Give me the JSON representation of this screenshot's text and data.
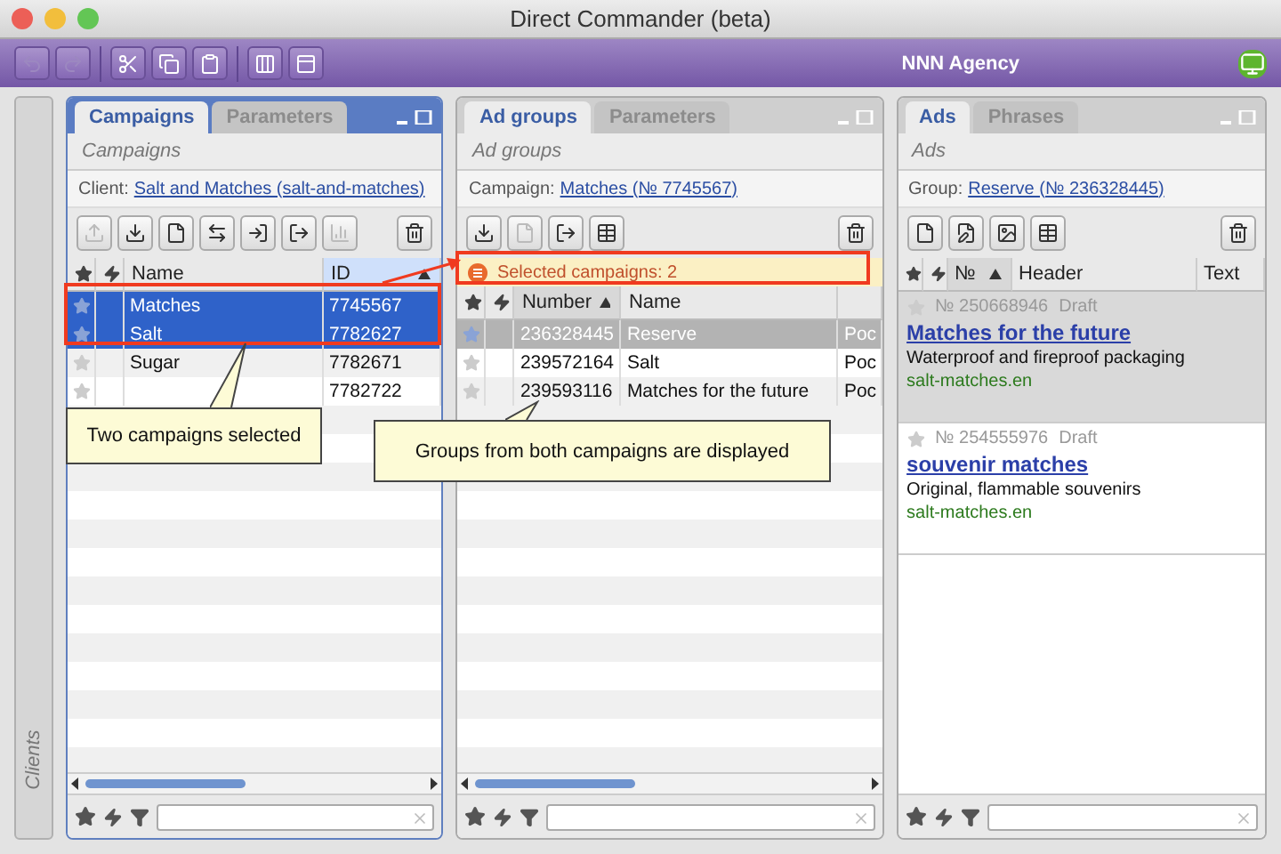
{
  "window": {
    "title": "Direct Commander (beta)"
  },
  "toolbar": [
    {
      "kind": "undo",
      "disabled": true
    },
    {
      "kind": "redo",
      "disabled": true
    },
    {
      "kind": "cut",
      "disabled": false
    },
    {
      "kind": "copy",
      "disabled": false
    },
    {
      "kind": "paste",
      "disabled": false
    },
    {
      "kind": "columns",
      "disabled": false
    },
    {
      "kind": "view",
      "disabled": false
    }
  ],
  "account": "NNN Agency",
  "sidebar": {
    "label": "Clients"
  },
  "panels": [
    {
      "kind": "table",
      "active": true,
      "tabs": [
        {
          "label": "Campaigns",
          "selected": true
        },
        {
          "label": "Parameters",
          "selected": false
        }
      ],
      "subtitle": "Campaigns",
      "filter": {
        "label": "Client:",
        "value": "Salt and Matches (salt-and-matches)"
      },
      "tools": [
        {
          "kind": "upload",
          "disabled": true
        },
        {
          "kind": "download",
          "disabled": false
        },
        {
          "kind": "file",
          "disabled": false
        },
        {
          "kind": "swap",
          "disabled": false
        },
        {
          "kind": "import",
          "disabled": false
        },
        {
          "kind": "export",
          "disabled": false
        },
        {
          "kind": "chart",
          "disabled": true
        }
      ],
      "columns": [
        {
          "label": "Name",
          "sorted": false
        },
        {
          "label": "ID",
          "sorted": true
        }
      ],
      "rows": [
        {
          "cells": [
            "Matches",
            "7745567"
          ],
          "selected": true
        },
        {
          "cells": [
            "Salt",
            "7782627"
          ],
          "selected": true
        },
        {
          "cells": [
            "Sugar",
            "7782671"
          ],
          "selected": false
        },
        {
          "cells": [
            null,
            "7782722"
          ],
          "selected": false
        }
      ]
    },
    {
      "kind": "table",
      "active": false,
      "tabs": [
        {
          "label": "Ad groups",
          "selected": true
        },
        {
          "label": "Parameters",
          "selected": false
        }
      ],
      "subtitle": "Ad groups",
      "filter": {
        "label": "Campaign:",
        "value": "Matches (№ 7745567)"
      },
      "tools": [
        {
          "kind": "download",
          "disabled": false
        },
        {
          "kind": "file",
          "disabled": true
        },
        {
          "kind": "export",
          "disabled": false
        },
        {
          "kind": "grid",
          "disabled": false
        }
      ],
      "notice": "Selected campaigns: 2",
      "columns": [
        {
          "label": "Number",
          "sorted": true
        },
        {
          "label": "Name",
          "sorted": false
        },
        {
          "sorted": false
        }
      ],
      "rows": [
        {
          "cells": [
            "236328445",
            "Reserve",
            "Poc"
          ],
          "selected": true
        },
        {
          "cells": [
            "239572164",
            "Salt",
            "Poc"
          ],
          "selected": false
        },
        {
          "cells": [
            "239593116",
            "Matches for the future",
            "Poc"
          ],
          "selected": false
        }
      ]
    },
    {
      "kind": "cards",
      "active": false,
      "tabs": [
        {
          "label": "Ads",
          "selected": true
        },
        {
          "label": "Phrases",
          "selected": false
        }
      ],
      "subtitle": "Ads",
      "filter": {
        "label": "Group:",
        "value": "Reserve (№ 236328445)"
      },
      "tools": [
        {
          "kind": "file",
          "disabled": false
        },
        {
          "kind": "edit",
          "disabled": false
        },
        {
          "kind": "image",
          "disabled": false
        },
        {
          "kind": "grid",
          "disabled": false
        }
      ],
      "columns": [
        {
          "label": "№",
          "sorted": true
        },
        {
          "label": "Header",
          "sorted": false
        },
        {
          "label": "Text",
          "sorted": false
        }
      ],
      "cards": [
        {
          "number": "№ 250668946",
          "status": "Draft",
          "title": "Matches for the future",
          "text": "Waterproof and fireproof packaging",
          "url": "salt-matches.en",
          "selected": true
        },
        {
          "number": "№ 254555976",
          "status": "Draft",
          "title": "souvenir matches",
          "text": "Original, flammable souvenirs",
          "url": "salt-matches.en",
          "selected": false
        }
      ]
    }
  ],
  "callouts": [
    {
      "text": "Two campaigns selected"
    },
    {
      "text": "Groups from both campaigns are displayed"
    }
  ]
}
